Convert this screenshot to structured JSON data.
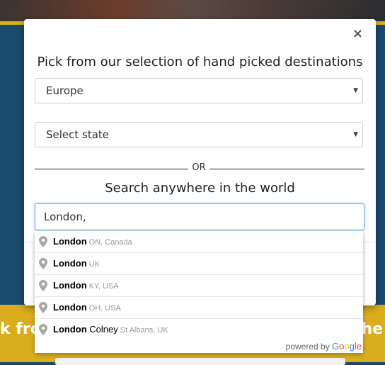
{
  "modal": {
    "close_label": "×",
    "title": "Pick from our selection of hand picked destinations",
    "region_select": {
      "selected": "Europe"
    },
    "state_select": {
      "selected": "Select state"
    },
    "or_label": "OR",
    "search_heading": "Search anywhere in the world",
    "search_input": {
      "value": "London,"
    }
  },
  "autocomplete": {
    "items": [
      {
        "match": "London",
        "rest": "",
        "secondary": "ON, Canada"
      },
      {
        "match": "London",
        "rest": "",
        "secondary": "UK"
      },
      {
        "match": "London",
        "rest": "",
        "secondary": "KY, USA"
      },
      {
        "match": "London",
        "rest": "",
        "secondary": "OH, USA"
      },
      {
        "match": "London",
        "rest": " Colney",
        "secondary": "St Albans, UK"
      }
    ],
    "powered_by": "powered by",
    "google": {
      "G": "G",
      "o1": "o",
      "o2": "o",
      "g": "g",
      "l": "l",
      "e": "e"
    }
  },
  "background": {
    "left_text": "k fro",
    "right_text": "the"
  },
  "colors": {
    "accent": "#d9ad1e",
    "page_bg": "#194b6e",
    "focus": "#66afe9"
  }
}
